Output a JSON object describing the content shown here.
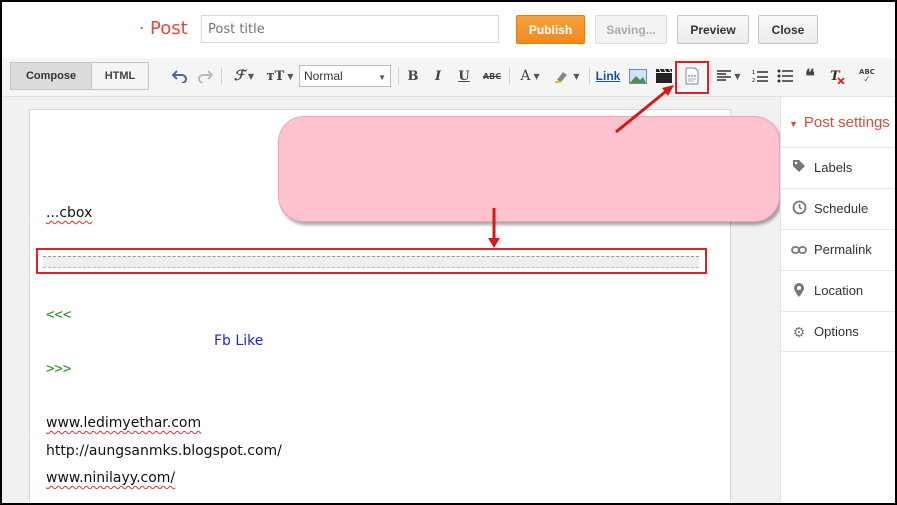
{
  "header": {
    "blog_title": "",
    "separator": "·",
    "post_label": "Post",
    "title_placeholder": "Post title",
    "publish_label": "Publish",
    "saving_label": "Saving...",
    "preview_label": "Preview",
    "close_label": "Close"
  },
  "toolbar": {
    "compose_label": "Compose",
    "html_label": "HTML",
    "font_value": "Normal",
    "bold": "B",
    "italic": "I",
    "underline": "U",
    "strike": "ABC",
    "text_color": "A",
    "link_label": "Link",
    "spell": "ABC",
    "caret": "▼"
  },
  "editor": {
    "line1": "",
    "line2": "",
    "line3": "",
    "line4_prefix": "",
    "line4_link": "...cbox",
    "line4_suffix": "",
    "open_marker": "<<<",
    "close_marker": ">>>",
    "footer1": "",
    "footer2_prefix": "",
    "footer2_link": "www.ledimyethar.com",
    "footer3_prefix": "",
    "footer3_link": "http://aungsanmks.blogspot.com/",
    "footer4_prefix": "",
    "footer4_link": "www.ninilayy.com/"
  },
  "callout": {
    "line1": "",
    "line2": ""
  },
  "watermark": {
    "title": "",
    "sub_red": "",
    "sub_blue": "Fb Like",
    "sub_rest": ""
  },
  "sidebar": {
    "heading": "Post settings",
    "items": [
      {
        "label": "Labels",
        "icon": "tag-icon"
      },
      {
        "label": "Schedule",
        "icon": "clock-icon"
      },
      {
        "label": "Permalink",
        "icon": "link-icon"
      },
      {
        "label": "Location",
        "icon": "pin-icon"
      },
      {
        "label": "Options",
        "icon": "gear-icon"
      }
    ]
  },
  "colors": {
    "accent": "#dd4b39",
    "publish": "#f08a1e",
    "highlight_box": "#e02020",
    "callout_bg": "#ffc2cf",
    "callout_text": "#1a1aff",
    "watermark": "#ffd21a"
  }
}
